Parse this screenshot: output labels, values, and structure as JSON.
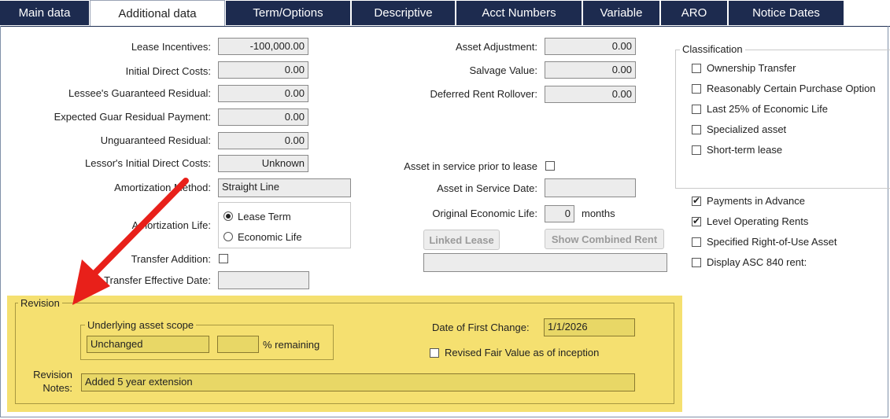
{
  "tabs": [
    {
      "label": "Main data"
    },
    {
      "label": "Additional data"
    },
    {
      "label": "Term/Options"
    },
    {
      "label": "Descriptive"
    },
    {
      "label": "Acct Numbers"
    },
    {
      "label": "Variable"
    },
    {
      "label": "ARO"
    },
    {
      "label": "Notice Dates"
    }
  ],
  "left": {
    "lease_incentives": {
      "label": "Lease Incentives:",
      "value": "-100,000.00"
    },
    "initial_direct_costs": {
      "label": "Initial Direct Costs:",
      "value": "0.00"
    },
    "lessee_guaranteed_residual": {
      "label": "Lessee's Guaranteed Residual:",
      "value": "0.00"
    },
    "expected_guar_residual_payment": {
      "label": "Expected Guar Residual Payment:",
      "value": "0.00"
    },
    "unguaranteed_residual": {
      "label": "Unguaranteed Residual:",
      "value": "0.00"
    },
    "lessor_initial_direct_costs": {
      "label": "Lessor's Initial Direct Costs:",
      "value": "Unknown"
    },
    "amortization_method": {
      "label": "Amortization Method:",
      "value": "Straight Line"
    },
    "amortization_life": {
      "label": "Amortization Life:",
      "options": [
        "Lease Term",
        "Economic Life"
      ],
      "selected": "Lease Term"
    },
    "transfer_addition": {
      "label": "Transfer Addition:",
      "checked": false
    },
    "transfer_effective_date": {
      "label": "Transfer Effective Date:",
      "value": ""
    }
  },
  "middle": {
    "asset_adjustment": {
      "label": "Asset Adjustment:",
      "value": "0.00"
    },
    "salvage_value": {
      "label": "Salvage Value:",
      "value": "0.00"
    },
    "deferred_rent_rollover": {
      "label": "Deferred Rent Rollover:",
      "value": "0.00"
    },
    "asset_in_service_prior": {
      "label": "Asset in service prior to lease",
      "checked": false
    },
    "asset_in_service_date": {
      "label": "Asset in Service Date:",
      "value": ""
    },
    "original_economic_life": {
      "label": "Original Economic Life:",
      "value": "0",
      "unit": "months"
    },
    "linked_lease_button": "Linked Lease",
    "show_combined_rent_button": "Show Combined Rent",
    "linked_lease_value": ""
  },
  "classification": {
    "legend": "Classification",
    "items": [
      {
        "label": "Ownership Transfer",
        "checked": false
      },
      {
        "label": "Reasonably Certain Purchase Option",
        "checked": false
      },
      {
        "label": "Last 25% of Economic Life",
        "checked": false
      },
      {
        "label": "Specialized asset",
        "checked": false
      },
      {
        "label": "Short-term lease",
        "checked": false
      }
    ]
  },
  "options": [
    {
      "label": "Payments in Advance",
      "checked": true
    },
    {
      "label": "Level Operating Rents",
      "checked": true
    },
    {
      "label": "Specified Right-of-Use Asset",
      "checked": false
    },
    {
      "label": "Display ASC 840 rent:",
      "checked": false
    }
  ],
  "revision": {
    "legend": "Revision",
    "underlying_scope_legend": "Underlying asset scope",
    "scope_value": "Unchanged",
    "percent_value": "",
    "percent_label": "% remaining",
    "date_first_change_label": "Date of First Change:",
    "date_first_change_value": "1/1/2026",
    "revised_fair_value_label": "Revised Fair Value as of inception",
    "revised_fair_value_checked": false,
    "notes_label_1": "Revision",
    "notes_label_2": "Notes:",
    "notes_value": "Added 5 year extension"
  },
  "colors": {
    "tab_bg": "#1d2b4f",
    "highlight": "#f5e070",
    "arrow": "#e8201a"
  }
}
